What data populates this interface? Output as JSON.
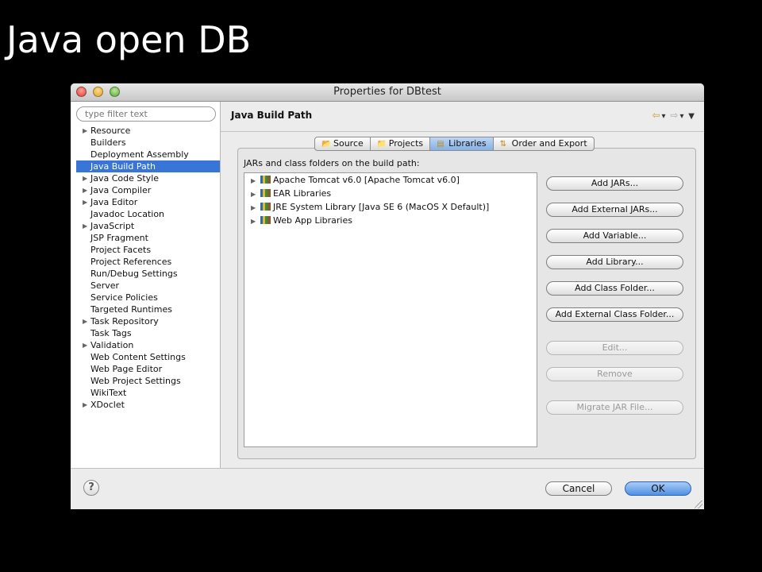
{
  "slide": {
    "title": "Java open DB"
  },
  "window": {
    "title": "Properties for DBtest"
  },
  "sidebar": {
    "filter_placeholder": "type filter text",
    "items": [
      {
        "label": "Resource",
        "expandable": true
      },
      {
        "label": "Builders",
        "expandable": false
      },
      {
        "label": "Deployment Assembly",
        "expandable": false
      },
      {
        "label": "Java Build Path",
        "expandable": false,
        "selected": true
      },
      {
        "label": "Java Code Style",
        "expandable": true
      },
      {
        "label": "Java Compiler",
        "expandable": true
      },
      {
        "label": "Java Editor",
        "expandable": true
      },
      {
        "label": "Javadoc Location",
        "expandable": false
      },
      {
        "label": "JavaScript",
        "expandable": true
      },
      {
        "label": "JSP Fragment",
        "expandable": false
      },
      {
        "label": "Project Facets",
        "expandable": false
      },
      {
        "label": "Project References",
        "expandable": false
      },
      {
        "label": "Run/Debug Settings",
        "expandable": false
      },
      {
        "label": "Server",
        "expandable": false
      },
      {
        "label": "Service Policies",
        "expandable": false
      },
      {
        "label": "Targeted Runtimes",
        "expandable": false
      },
      {
        "label": "Task Repository",
        "expandable": true
      },
      {
        "label": "Task Tags",
        "expandable": false
      },
      {
        "label": "Validation",
        "expandable": true
      },
      {
        "label": "Web Content Settings",
        "expandable": false
      },
      {
        "label": "Web Page Editor",
        "expandable": false
      },
      {
        "label": "Web Project Settings",
        "expandable": false
      },
      {
        "label": "WikiText",
        "expandable": false
      },
      {
        "label": "XDoclet",
        "expandable": true
      }
    ]
  },
  "main": {
    "page_title": "Java Build Path",
    "tabs": [
      {
        "label": "Source",
        "icon": "source-folder-icon"
      },
      {
        "label": "Projects",
        "icon": "projects-folder-icon"
      },
      {
        "label": "Libraries",
        "icon": "libraries-icon",
        "active": true
      },
      {
        "label": "Order and Export",
        "icon": "order-export-icon"
      }
    ],
    "section_label": "JARs and class folders on the build path:",
    "libraries": [
      {
        "label": "Apache Tomcat v6.0 [Apache Tomcat v6.0]"
      },
      {
        "label": "EAR Libraries"
      },
      {
        "label": "JRE System Library [Java SE 6 (MacOS X Default)]"
      },
      {
        "label": "Web App Libraries"
      }
    ],
    "buttons": [
      {
        "label": "Add JARs...",
        "enabled": true,
        "name": "add-jars-button"
      },
      {
        "label": "Add External JARs...",
        "enabled": true,
        "name": "add-external-jars-button"
      },
      {
        "label": "Add Variable...",
        "enabled": true,
        "name": "add-variable-button"
      },
      {
        "label": "Add Library...",
        "enabled": true,
        "name": "add-library-button"
      },
      {
        "label": "Add Class Folder...",
        "enabled": true,
        "name": "add-class-folder-button"
      },
      {
        "label": "Add External Class Folder...",
        "enabled": true,
        "name": "add-external-class-folder-button"
      },
      {
        "label": "Edit...",
        "enabled": false,
        "name": "edit-button"
      },
      {
        "label": "Remove",
        "enabled": false,
        "name": "remove-button"
      },
      {
        "label": "Migrate JAR File...",
        "enabled": false,
        "name": "migrate-jar-file-button"
      }
    ]
  },
  "footer": {
    "help": "?",
    "cancel": "Cancel",
    "ok": "OK"
  },
  "colors": {
    "selection": "#3875d7",
    "active_tab": "#86b0e4",
    "ok_button": "#4f91e3"
  }
}
